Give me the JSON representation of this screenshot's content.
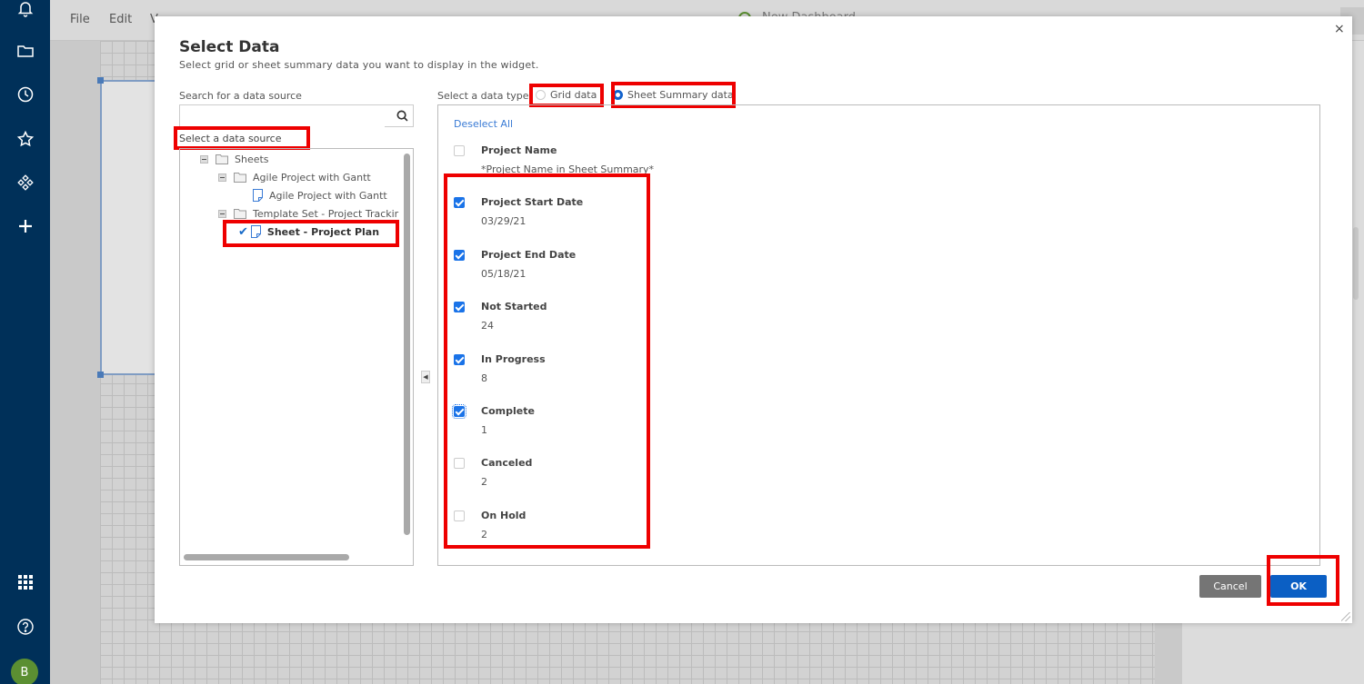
{
  "app": {
    "menu": [
      "File",
      "Edit",
      "V"
    ],
    "document_title": "New Dashboard",
    "user_initial": "B",
    "colors": {
      "nav_bg": "#003059",
      "accent": "#1a73e8",
      "ok_button": "#0b5fc4",
      "annotation_red": "#ee0000",
      "avatar": "#5b8f32"
    }
  },
  "left_nav": {
    "icons": [
      "bell-icon",
      "folder-icon",
      "clock-icon",
      "star-icon",
      "solutions-icon",
      "plus-icon",
      "apps-grid-icon",
      "help-icon"
    ]
  },
  "modal": {
    "title": "Select Data",
    "subtitle": "Select grid or sheet summary data you want to display in the widget.",
    "close_label": "×",
    "search": {
      "label": "Search for a data source",
      "value": "",
      "placeholder": ""
    },
    "source_label": "Select a data source",
    "tree": [
      {
        "label": "Sheets",
        "type": "folder",
        "level": 0,
        "expanded": true
      },
      {
        "label": "Agile Project with Gantt",
        "type": "folder",
        "level": 1,
        "expanded": true
      },
      {
        "label": "Agile Project with Gantt",
        "type": "sheet",
        "level": 2
      },
      {
        "label": "Template Set - Project Trackir",
        "type": "folder",
        "level": 1,
        "expanded": true
      },
      {
        "label": "Sheet - Project Plan",
        "type": "sheet",
        "level": 2,
        "selected": true
      }
    ],
    "data_type": {
      "label": "Select a data type",
      "options": [
        {
          "label": "Grid data",
          "selected": false
        },
        {
          "label": "Sheet Summary data",
          "selected": true
        }
      ]
    },
    "deselect_all": "Deselect All",
    "fields": [
      {
        "name": "Project Name",
        "value": "*Project Name in Sheet Summary*",
        "checked": false
      },
      {
        "name": "Project Start Date",
        "value": "03/29/21",
        "checked": true
      },
      {
        "name": "Project End Date",
        "value": "05/18/21",
        "checked": true
      },
      {
        "name": "Not Started",
        "value": "24",
        "checked": true
      },
      {
        "name": "In Progress",
        "value": "8",
        "checked": true
      },
      {
        "name": "Complete",
        "value": "1",
        "checked": true
      },
      {
        "name": "Canceled",
        "value": "2",
        "checked": false
      },
      {
        "name": "On Hold",
        "value": "2",
        "checked": false
      }
    ],
    "buttons": {
      "cancel": "Cancel",
      "ok": "OK"
    }
  }
}
